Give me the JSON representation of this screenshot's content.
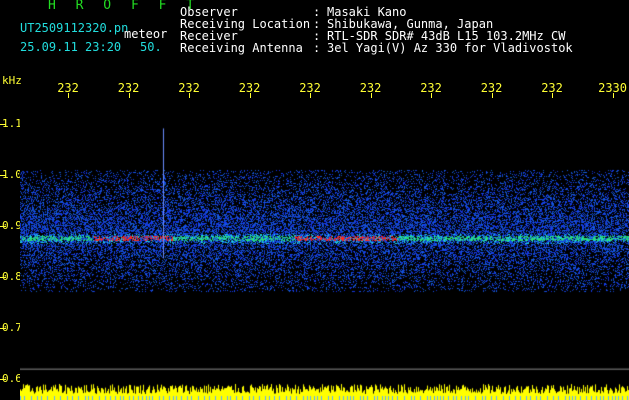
{
  "app": {
    "title": "H R O F F T"
  },
  "file": {
    "name": "UT2509112320.pn",
    "type": "meteor",
    "datetime": "25.09.11 23:20",
    "count": "50."
  },
  "meta": [
    {
      "label": "Observer",
      "value": "Masaki Kano"
    },
    {
      "label": "Receiving Location",
      "value": "Shibukawa, Gunma, Japan"
    },
    {
      "label": "Receiver",
      "value": "RTL-SDR SDR# 43dB L15 103.2MHz CW"
    },
    {
      "label": "Receiving Antenna",
      "value": "3el Yagi(V) Az 330 for Vladivostok"
    }
  ],
  "chart_data": {
    "type": "heatmap",
    "ylabel": "kHz",
    "x_ticks": [
      "232",
      "232",
      "232",
      "232",
      "232",
      "232",
      "232",
      "232",
      "232",
      "2330"
    ],
    "y_ticks": [
      "1.1",
      "1.0",
      "0.9",
      "0.8",
      "0.7",
      "0.6"
    ],
    "ylim": [
      0.6,
      1.15
    ],
    "signal_center_khz": 0.875,
    "noise_band_khz": [
      0.79,
      0.99
    ],
    "colors": {
      "background": "#000000",
      "noise": "#1a2fd8",
      "signal": "#ff2020",
      "axis": "#ffff33",
      "histogram": "#ffff00"
    }
  }
}
